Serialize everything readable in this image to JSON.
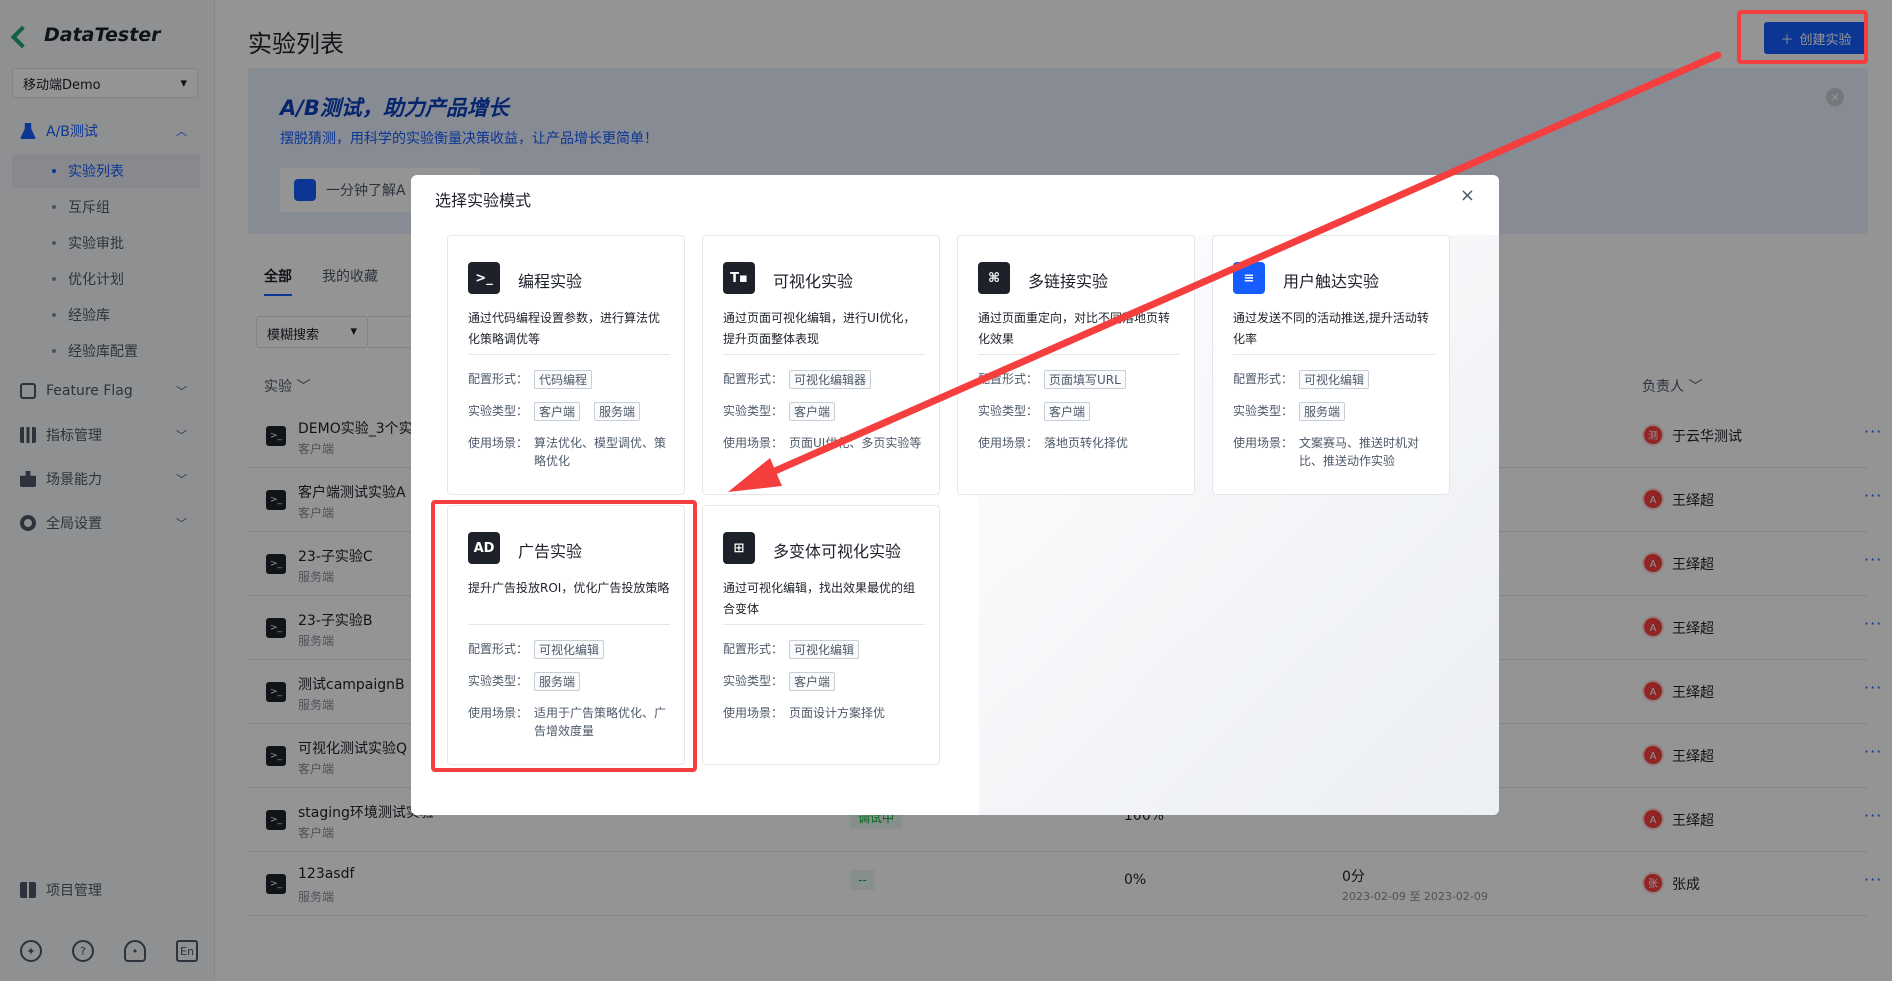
{
  "app": {
    "name": "DataTester",
    "project": "移动端Demo"
  },
  "sidebar": {
    "groups": [
      {
        "label": "A/B测试",
        "active": true
      },
      {
        "label": "Feature Flag"
      },
      {
        "label": "指标管理"
      },
      {
        "label": "场景能力"
      },
      {
        "label": "全局设置"
      }
    ],
    "subitems": [
      "实验列表",
      "互斥组",
      "实验审批",
      "优化计划",
      "经验库",
      "经验库配置"
    ],
    "bottom": "项目管理",
    "footer_lang": "En"
  },
  "header": {
    "title": "实验列表",
    "create_button": "创建实验"
  },
  "banner": {
    "title": "A/B测试，助力产品增长",
    "subtitle": "摆脱猜测，用科学的实验衡量决策收益，让产品增长更简单！",
    "card": "一分钟了解A"
  },
  "tabs": [
    "全部",
    "我的收藏"
  ],
  "filter": {
    "label": "模糊搜索"
  },
  "table": {
    "col_experiment": "实验",
    "col_owner": "负责人",
    "rows": [
      {
        "name": "DEMO实验_3个实",
        "type": "客户端",
        "owner": "于云华测试",
        "avatar": "测试"
      },
      {
        "name": "客户端测试实验A",
        "type": "客户端",
        "owner": "王绎超",
        "avatar": "A"
      },
      {
        "name": "23-子实验C",
        "type": "服务端",
        "owner": "王绎超",
        "avatar": "A"
      },
      {
        "name": "23-子实验B",
        "type": "服务端",
        "owner": "王绎超",
        "avatar": "A"
      },
      {
        "name": "测试campaignB",
        "type": "服务端",
        "owner": "王绎超",
        "avatar": "A"
      },
      {
        "name": "可视化测试实验Q",
        "type": "客户端",
        "owner": "王绎超",
        "avatar": "A"
      },
      {
        "name": "staging环境测试实验",
        "type": "客户端",
        "owner": "王绎超",
        "avatar": "A",
        "status": "调试中",
        "percent": "100%",
        "score": "--"
      },
      {
        "name": "123asdf",
        "type": "服务端",
        "owner": "张成",
        "avatar": "张成",
        "status": "--",
        "percent": "0%",
        "score": "0分",
        "date": "2023-02-09 至 2023-02-09"
      }
    ],
    "more": "···"
  },
  "modal": {
    "title": "选择实验模式",
    "labels": {
      "config": "配置形式：",
      "type": "实验类型：",
      "scene": "使用场景："
    },
    "cards": [
      {
        "title": "编程实验",
        "desc": "通过代码编程设置参数，进行算法优化策略调优等",
        "config": "代码编程",
        "types": [
          "客户端",
          "服务端"
        ],
        "scene": "算法优化、模型调优、策略优化",
        "icon": "terminal-icon",
        "icon_color": "#1d2129",
        "glyph": ">_"
      },
      {
        "title": "可视化实验",
        "desc": "通过页面可视化编辑，进行UI优化，提升页面整体表现",
        "config": "可视化编辑器",
        "types": [
          "客户端"
        ],
        "scene": "页面UI优化、多页实验等",
        "icon": "visual-icon",
        "icon_color": "#1d2129",
        "glyph": "T▪"
      },
      {
        "title": "多链接实验",
        "desc": "通过页面重定向，对比不同落地页转化效果",
        "config": "页面填写URL",
        "types": [
          "客户端"
        ],
        "scene": "落地页转化择优",
        "icon": "sitemap-icon",
        "icon_color": "#1d2129",
        "glyph": "⌘"
      },
      {
        "title": "用户触达实验",
        "desc": "通过发送不同的活动推送,提升活动转化率",
        "config": "可视化编辑",
        "types": [
          "服务端"
        ],
        "scene": "文案赛马、推送时机对比、推送动作实验",
        "icon": "message-icon",
        "icon_color": "#165dff",
        "glyph": "≡"
      },
      {
        "title": "广告实验",
        "desc": "提升广告投放ROI，优化广告投放策略",
        "config": "可视化编辑",
        "types": [
          "服务端"
        ],
        "scene": "适用于广告策略优化、广告增效度量",
        "icon": "ad-icon",
        "icon_color": "#1d2129",
        "glyph": "AD"
      },
      {
        "title": "多变体可视化实验",
        "desc": "通过可视化编辑，找出效果最优的组合变体",
        "config": "可视化编辑",
        "types": [
          "客户端"
        ],
        "scene": "页面设计方案择优",
        "icon": "multivariant-icon",
        "icon_color": "#1d2129",
        "glyph": "⊞"
      }
    ]
  },
  "annotation": {
    "color": "#f53f3f"
  }
}
